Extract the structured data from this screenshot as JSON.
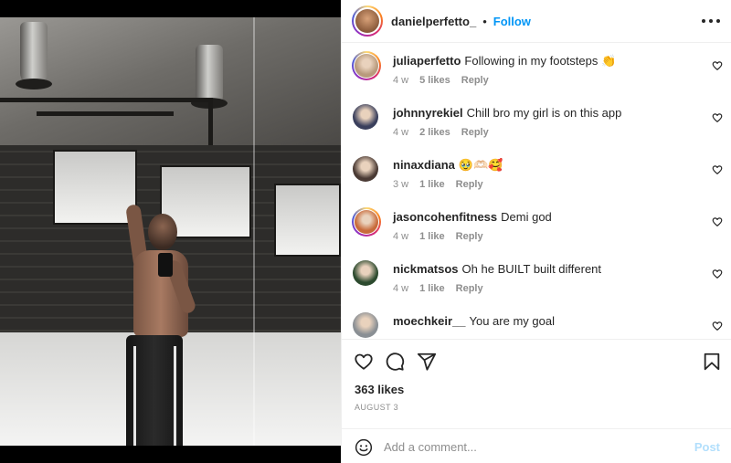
{
  "post": {
    "username": "danielperfetto_",
    "separator": "•",
    "follow_label": "Follow",
    "more_icon": "more-horizontal-icon",
    "likes": "363 likes",
    "date": "AUGUST 3"
  },
  "comments": [
    {
      "username": "juliaperfetto",
      "text": "Following in my footsteps 👏",
      "age": "4 w",
      "likes": "5 likes",
      "reply": "Reply",
      "story_ring": true,
      "avatar_color": "#b89a7c"
    },
    {
      "username": "johnnyrekiel",
      "text": "Chill bro my girl is on this app",
      "age": "4 w",
      "likes": "2 likes",
      "reply": "Reply",
      "story_ring": false,
      "avatar_color": "#3a3f5c"
    },
    {
      "username": "ninaxdiana",
      "text": "🥹🫶🏻🥰",
      "age": "3 w",
      "likes": "1 like",
      "reply": "Reply",
      "story_ring": false,
      "avatar_color": "#4a3a34"
    },
    {
      "username": "jasoncohenfitness",
      "text": "Demi god",
      "age": "4 w",
      "likes": "1 like",
      "reply": "Reply",
      "story_ring": true,
      "avatar_color": "#c86a3a"
    },
    {
      "username": "nickmatsos",
      "text": "Oh he BUILT built different",
      "age": "4 w",
      "likes": "1 like",
      "reply": "Reply",
      "story_ring": false,
      "avatar_color": "#2c4a2e"
    },
    {
      "username": "moechkeir__",
      "text": "You are my goal",
      "age": "",
      "likes": "",
      "reply": "",
      "story_ring": false,
      "avatar_color": "#8a8f94"
    }
  ],
  "add_comment": {
    "placeholder": "Add a comment...",
    "post_label": "Post"
  },
  "colors": {
    "accent": "#0095f6",
    "post_disabled": "#b2dffc",
    "text": "#262626",
    "muted": "#8e8e8e"
  }
}
